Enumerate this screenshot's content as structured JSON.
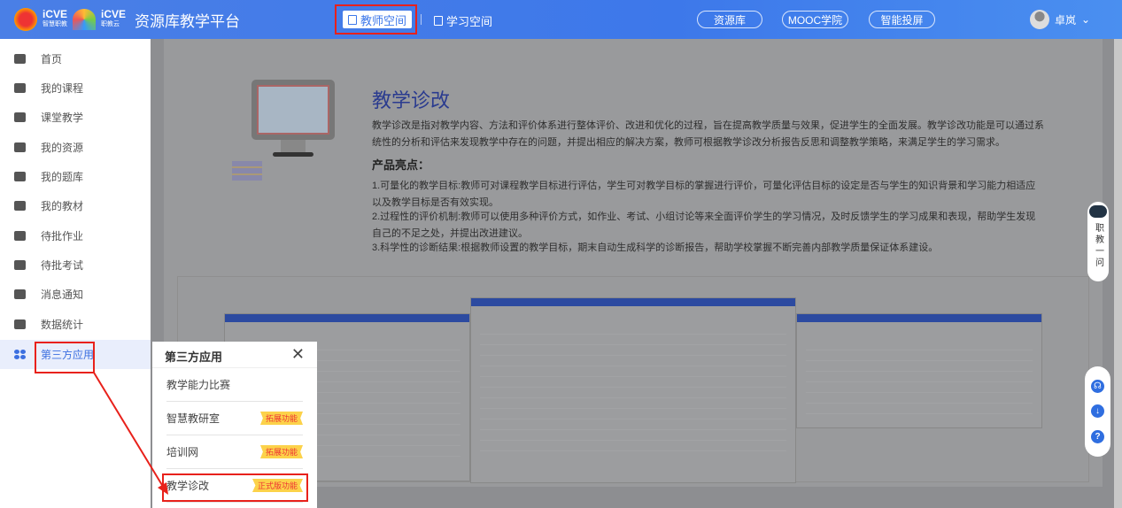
{
  "header": {
    "logo_text_1": "iCVE",
    "logo_sub_1": "智慧职教",
    "logo_text_2": "iCVE",
    "logo_sub_2": "职教云",
    "site_title": "资源库教学平台",
    "nav": [
      {
        "label": "教师空间",
        "active": true
      },
      {
        "label": "学习空间",
        "active": false
      }
    ],
    "pills": [
      "资源库",
      "MOOC学院",
      "智能投屏"
    ],
    "user_name": "卓岚"
  },
  "sidebar": {
    "items": [
      {
        "label": "首页",
        "icon": "home-icon"
      },
      {
        "label": "我的课程",
        "icon": "book-icon"
      },
      {
        "label": "课堂教学",
        "icon": "play-icon"
      },
      {
        "label": "我的资源",
        "icon": "library-icon"
      },
      {
        "label": "我的题库",
        "icon": "question-bank-icon"
      },
      {
        "label": "我的教材",
        "icon": "textbook-icon"
      },
      {
        "label": "待批作业",
        "icon": "homework-icon"
      },
      {
        "label": "待批考试",
        "icon": "exam-icon"
      },
      {
        "label": "消息通知",
        "icon": "message-icon"
      },
      {
        "label": "数据统计",
        "icon": "stats-icon"
      },
      {
        "label": "第三方应用",
        "icon": "apps-icon",
        "active": true
      }
    ]
  },
  "main": {
    "title": "教学诊改",
    "intro": "教学诊改是指对教学内容、方法和评价体系进行整体评价、改进和优化的过程，旨在提高教学质量与效果，促进学生的全面发展。教学诊改功能是可以通过系统性的分析和评估来发现教学中存在的问题，并提出相应的解决方案，教师可根据教学诊改分析报告反思和调整教学策略，来满足学生的学习需求。",
    "highlights_title": "产品亮点：",
    "highlights": [
      "1.可量化的教学目标:教师可对课程教学目标进行评估，学生可对教学目标的掌握进行评价，可量化评估目标的设定是否与学生的知识背景和学习能力相适应以及教学目标是否有效实现。",
      "2.过程性的评价机制:教师可以使用多种评价方式，如作业、考试、小组讨论等来全面评价学生的学习情况，及时反馈学生的学习成果和表现，帮助学生发现自己的不足之处，并提出改进建议。",
      "3.科学性的诊断结果:根据教师设置的教学目标，期末自动生成科学的诊断报告，帮助学校掌握不断完善内部教学质量保证体系建设。"
    ]
  },
  "float": {
    "assistant_label": "职教一问",
    "buttons": [
      "headset-icon",
      "download-icon",
      "help-icon"
    ]
  },
  "popup": {
    "title": "第三方应用",
    "items": [
      {
        "label": "教学能力比赛",
        "badge": ""
      },
      {
        "label": "智慧教研室",
        "badge": "拓展功能"
      },
      {
        "label": "培训网",
        "badge": "拓展功能"
      },
      {
        "label": "教学诊改",
        "badge": "正式版功能"
      }
    ]
  },
  "colors": {
    "header": "#3d78ea",
    "accent": "#3c6fe0",
    "annotation": "#e8211b",
    "badge": "#fcd24a"
  }
}
